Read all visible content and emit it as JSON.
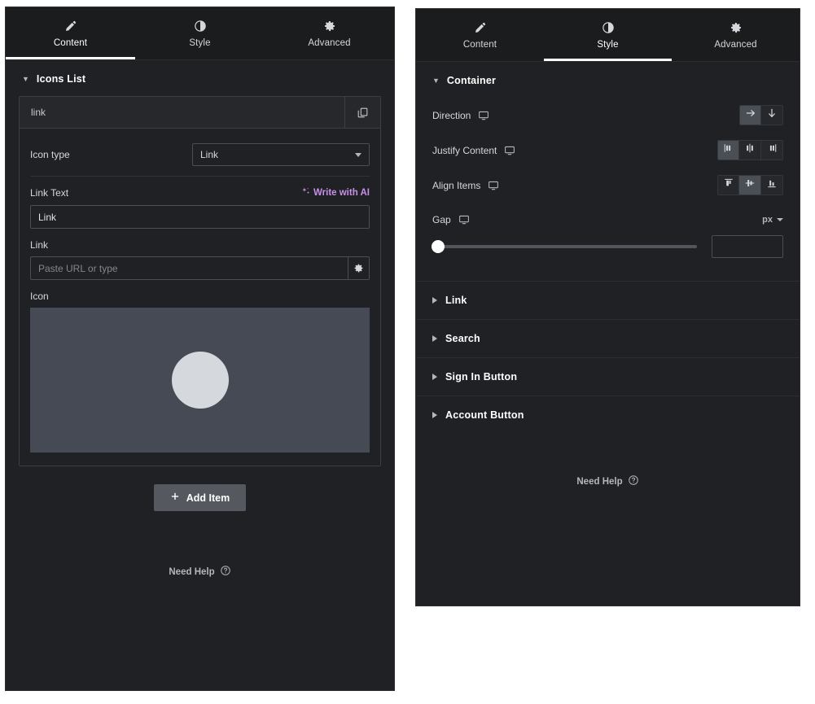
{
  "left_panel": {
    "tabs": [
      {
        "label": "Content",
        "icon": "pencil-icon",
        "active": true
      },
      {
        "label": "Style",
        "icon": "contrast-circle-icon",
        "active": false
      },
      {
        "label": "Advanced",
        "icon": "gear-icon",
        "active": false
      }
    ],
    "section": {
      "title": "Icons List",
      "caret": "▼"
    },
    "repeater_item": {
      "title": "link",
      "duplicate_icon": "duplicate-icon",
      "icon_type": {
        "label": "Icon type",
        "value": "Link"
      },
      "link_text": {
        "label": "Link Text",
        "ai_label": "Write with AI",
        "ai_icon": "sparkle-icon",
        "value": "Link"
      },
      "link": {
        "label": "Link",
        "value": "",
        "placeholder": "Paste URL or type",
        "options_icon": "gear-icon"
      },
      "icon": {
        "label": "Icon",
        "preview_shape": "circle"
      }
    },
    "add_item": {
      "label": "Add Item",
      "icon": "plus-icon"
    },
    "need_help": {
      "label": "Need Help",
      "icon": "question-circle-icon"
    }
  },
  "right_panel": {
    "tabs": [
      {
        "label": "Content",
        "icon": "pencil-icon",
        "active": false
      },
      {
        "label": "Style",
        "icon": "contrast-circle-icon",
        "active": true
      },
      {
        "label": "Advanced",
        "icon": "gear-icon",
        "active": false
      }
    ],
    "section": {
      "title": "Container",
      "caret": "▼"
    },
    "controls": {
      "direction": {
        "label": "Direction",
        "device_icon": "desktop-icon",
        "options": [
          {
            "name": "row",
            "icon": "arrow-right-icon",
            "selected": true
          },
          {
            "name": "column",
            "icon": "arrow-down-icon",
            "selected": false
          }
        ]
      },
      "justify_content": {
        "label": "Justify Content",
        "device_icon": "desktop-icon",
        "options": [
          {
            "name": "flex-start",
            "icon": "justify-start-icon",
            "selected": true
          },
          {
            "name": "center",
            "icon": "justify-center-icon",
            "selected": false
          },
          {
            "name": "flex-end",
            "icon": "justify-end-icon",
            "selected": false
          }
        ]
      },
      "align_items": {
        "label": "Align Items",
        "device_icon": "desktop-icon",
        "options": [
          {
            "name": "flex-start",
            "icon": "align-top-icon",
            "selected": false
          },
          {
            "name": "center",
            "icon": "align-middle-icon",
            "selected": true
          },
          {
            "name": "flex-end",
            "icon": "align-bottom-icon",
            "selected": false
          }
        ]
      },
      "gap": {
        "label": "Gap",
        "device_icon": "desktop-icon",
        "unit": "px",
        "value": "",
        "slider_percent": 0
      }
    },
    "sections": [
      {
        "title": "Link"
      },
      {
        "title": "Search"
      },
      {
        "title": "Sign In Button"
      },
      {
        "title": "Account Button"
      }
    ],
    "need_help": {
      "label": "Need Help",
      "icon": "question-circle-icon"
    }
  },
  "colors": {
    "panel_bg": "#1f2124",
    "tabbar_bg": "#1a1c1e",
    "accent_ai": "#c88fe8",
    "icon_preview_bg": "#454a54",
    "button_bg": "#55585f",
    "active_tab_underline": "#ffffff"
  }
}
